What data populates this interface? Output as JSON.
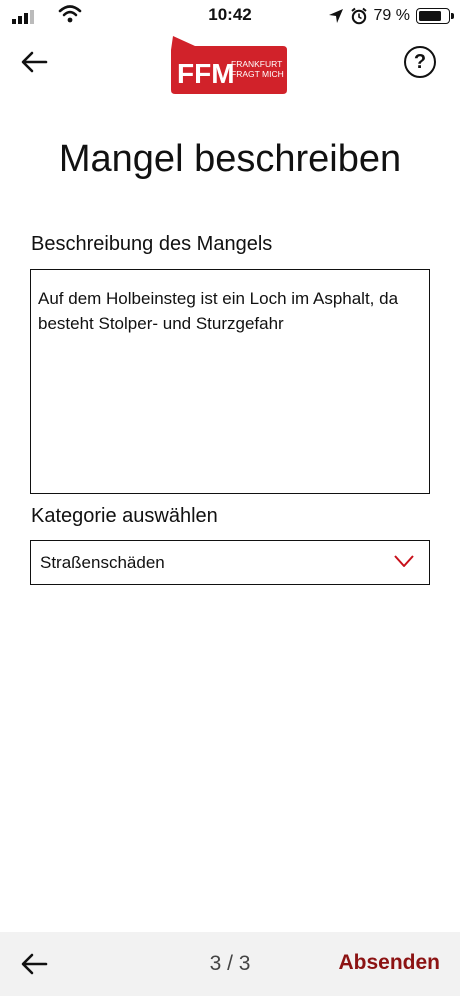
{
  "status": {
    "time": "10:42",
    "battery": "79 %",
    "battery_level": 0.79
  },
  "header": {
    "logo_text": "FFM",
    "logo_line1": "FRANKFURT",
    "logo_line2": "FRAGT MICH",
    "help_symbol": "?"
  },
  "page": {
    "title": "Mangel beschreiben"
  },
  "form": {
    "description_label": "Beschreibung des Mangels",
    "description_value": "Auf dem Holbeinsteg ist ein Loch im Asphalt, da besteht Stolper- und Sturzgefahr",
    "category_label": "Kategorie auswählen",
    "category_value": "Straßenschäden"
  },
  "footer": {
    "page_indicator": "3 / 3",
    "submit_label": "Absenden"
  },
  "colors": {
    "brand_red": "#d1222a",
    "submit_red": "#8c1313",
    "chevron_red": "#c8101a"
  },
  "icons": [
    "signal-icon",
    "wifi-icon",
    "location-icon",
    "alarm-icon",
    "battery-icon",
    "back-arrow-icon",
    "help-icon",
    "chevron-down-icon"
  ]
}
